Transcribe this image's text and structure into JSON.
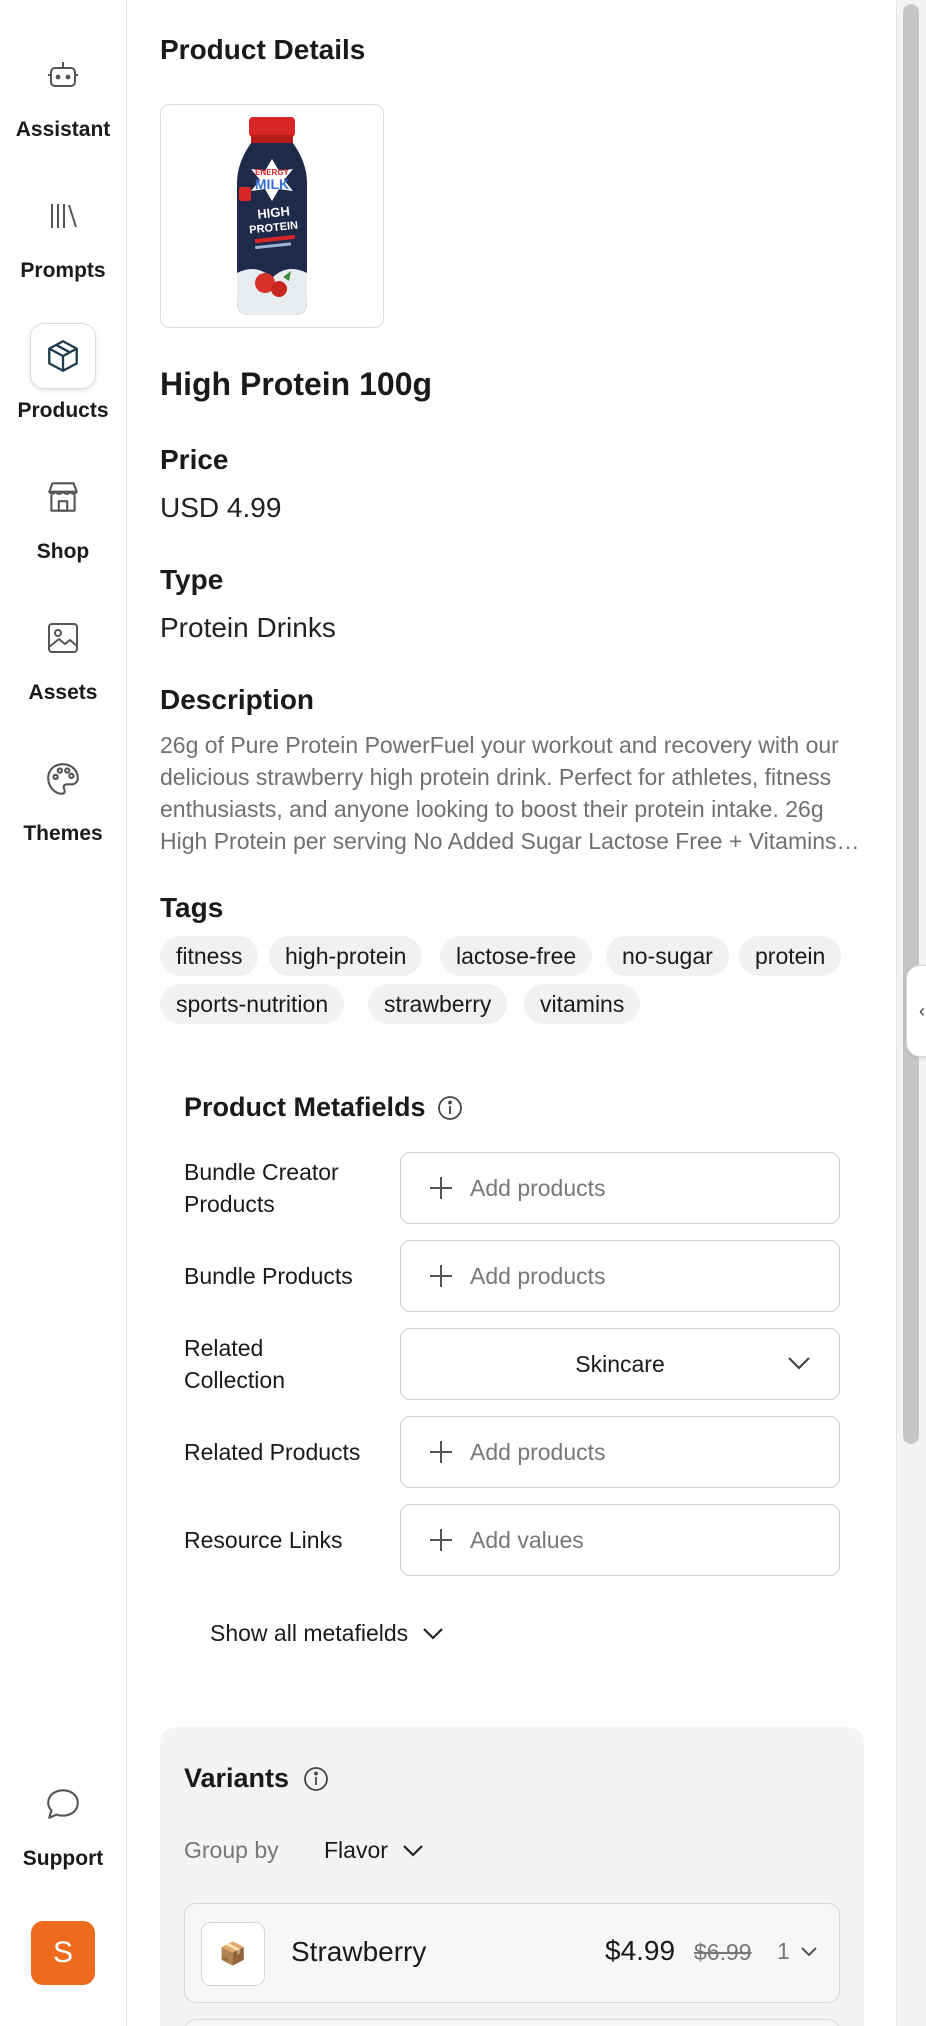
{
  "sidebar": {
    "items": [
      {
        "label": "Assistant",
        "icon": "robot-icon"
      },
      {
        "label": "Prompts",
        "icon": "library-icon"
      },
      {
        "label": "Products",
        "icon": "box-icon",
        "active": true
      },
      {
        "label": "Shop",
        "icon": "store-icon"
      },
      {
        "label": "Assets",
        "icon": "image-icon"
      },
      {
        "label": "Themes",
        "icon": "palette-icon"
      }
    ],
    "support_label": "Support",
    "avatar_letter": "S",
    "avatar_color": "#ee6a1c"
  },
  "page": {
    "title": "Product Details"
  },
  "product": {
    "name": "High Protein 100g",
    "price_label": "Price",
    "price_value": "USD 4.99",
    "type_label": "Type",
    "type_value": "Protein Drinks",
    "description_label": "Description",
    "description": "26g of Pure Protein PowerFuel your workout and recovery with our delicious strawberry high protein drink. Perfect for athletes, fitness enthusiasts, and anyone looking to boost their protein intake. 26g High Protein per serving No Added Sugar Lactose Free + Vitamins…",
    "tags_label": "Tags",
    "tags": [
      "fitness",
      "high-protein",
      "lactose-free",
      "no-sugar",
      "protein",
      "sports-nutrition",
      "strawberry",
      "vitamins"
    ],
    "image_bottle_text": [
      "ENERGY",
      "MILK",
      "HIGH",
      "PROTEIN"
    ]
  },
  "metafields": {
    "title": "Product Metafields",
    "rows": [
      {
        "label": "Bundle Creator Products",
        "placeholder": "Add products"
      },
      {
        "label": "Bundle Products",
        "placeholder": "Add products"
      },
      {
        "label": "Related Collection",
        "value": "Skincare"
      },
      {
        "label": "Related Products",
        "placeholder": "Add products"
      },
      {
        "label": "Resource Links",
        "placeholder": "Add values"
      }
    ],
    "show_all_label": "Show all metafields"
  },
  "variants": {
    "title": "Variants",
    "group_by_label": "Group by",
    "group_by_value": "Flavor",
    "items": [
      {
        "name": "Strawberry",
        "price": "$4.99",
        "compare_price": "$6.99",
        "quantity": "1",
        "thumb_icon": "📦"
      }
    ]
  },
  "colors": {
    "accent": "#ee6a1c",
    "icon_dark": "#1f3b4d"
  }
}
